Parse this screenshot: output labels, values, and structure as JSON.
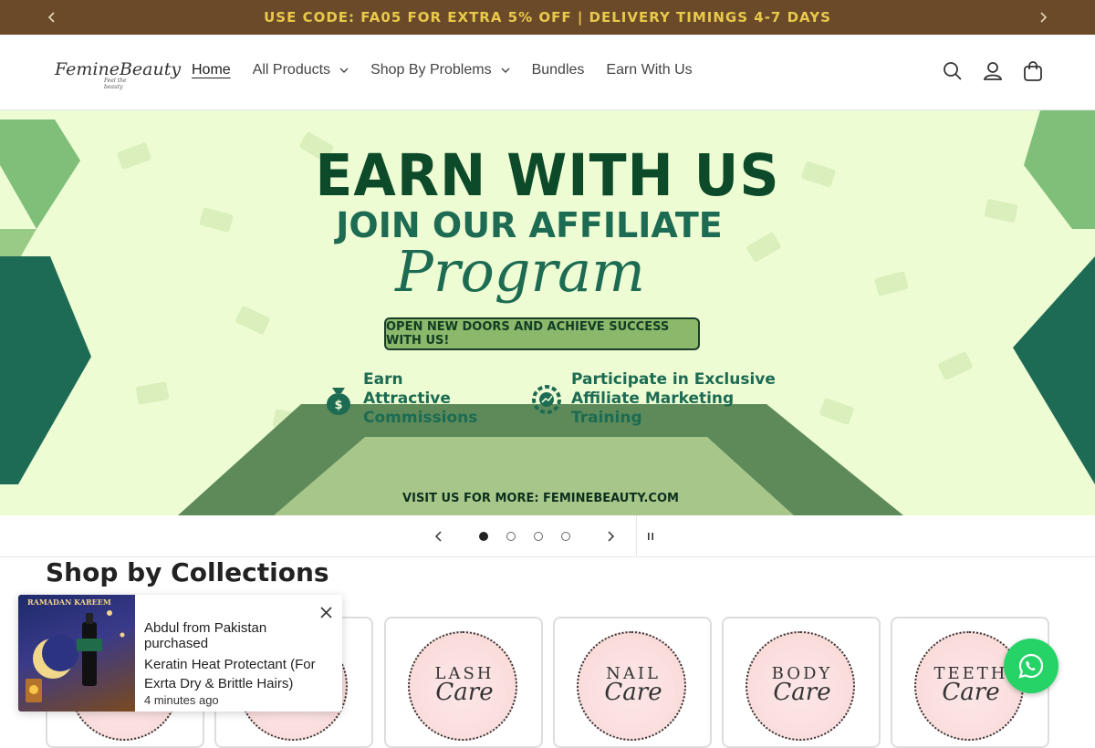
{
  "announcement": {
    "text": "USE CODE: FA05 FOR EXTRA 5% OFF | DELIVERY TIMINGS 4-7 DAYS"
  },
  "header": {
    "logo_text": "FemineBeauty",
    "logo_tagline": "Feel the beauty",
    "nav": [
      {
        "label": "Home",
        "active": true
      },
      {
        "label": "All Products",
        "dropdown": true
      },
      {
        "label": "Shop By Problems",
        "dropdown": true
      },
      {
        "label": "Bundles"
      },
      {
        "label": "Earn With Us"
      }
    ],
    "icons": [
      "search-icon",
      "account-icon",
      "cart-icon"
    ]
  },
  "hero": {
    "title1": "EARN WITH US",
    "title2": "JOIN OUR AFFILIATE",
    "script": "Program",
    "pill": "OPEN NEW DOORS AND ACHIEVE SUCCESS WITH US!",
    "feature1": "Earn Attractive Commissions",
    "feature2": "Participate in Exclusive Affiliate Marketing Training",
    "footer": "VISIT US FOR MORE: FEMINEBEAUTY.COM",
    "colors": {
      "bg": "#eefcd4",
      "dark_green": "#0d4a2a",
      "teal": "#1c6b52",
      "pill": "#8bb86a"
    }
  },
  "slider": {
    "slide_count": 4,
    "current_slide": 1
  },
  "collections": {
    "title": "Shop by Collections",
    "cards": [
      {
        "line1": "",
        "line2": ""
      },
      {
        "line1": "",
        "line2": ""
      },
      {
        "line1": "LASH",
        "line2": "Care"
      },
      {
        "line1": "NAIL",
        "line2": "Care"
      },
      {
        "line1": "BODY",
        "line2": "Care"
      },
      {
        "line1": "TEETH",
        "line2": "Care"
      }
    ]
  },
  "popup": {
    "buyer": "Abdul from Pakistan purchased",
    "product": "Keratin Heat Protectant (For Exrta Dry & Brittle Hairs)",
    "time": "4 minutes ago",
    "image_tag": "RAMADAN KAREEM"
  },
  "whatsapp": {
    "icon": "whatsapp-icon",
    "color": "#25d366"
  }
}
